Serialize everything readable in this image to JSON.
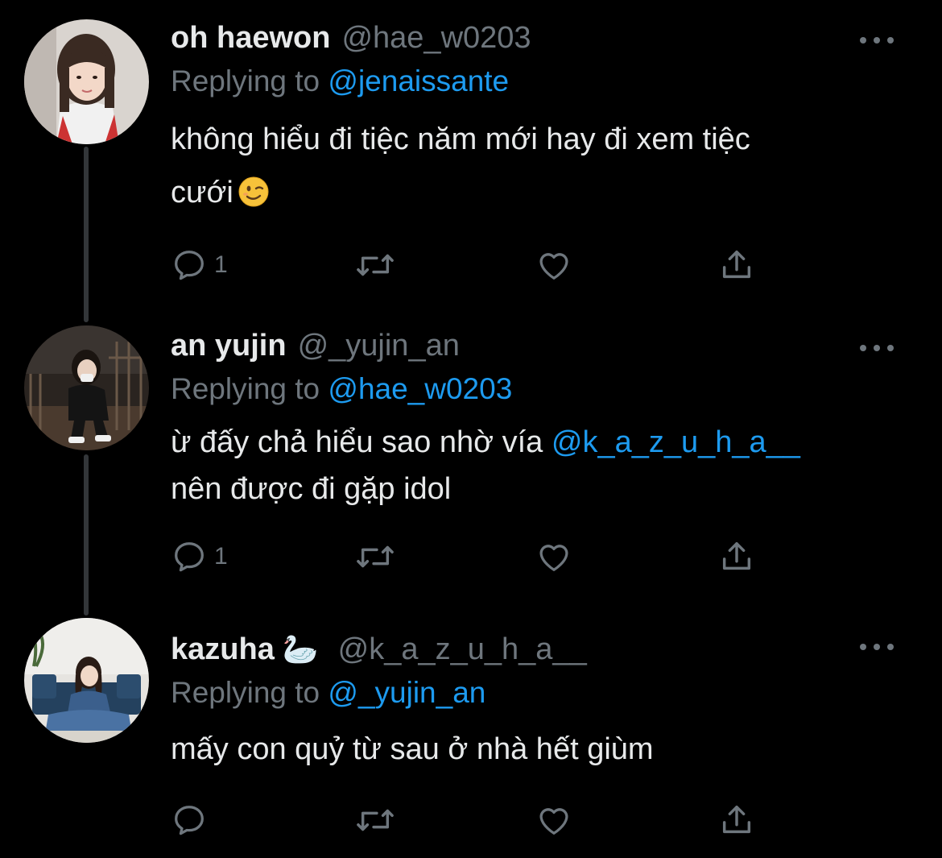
{
  "tweets": [
    {
      "display_name": "oh haewon",
      "handle": "@hae_w0203",
      "replying_label": "Replying to",
      "replying_to": "@jenaissante",
      "text_lines": [
        "không hiểu đi tiệc năm mới hay đi xem tiệc",
        "cưới"
      ],
      "inline_emoji": "winking-face",
      "reply_count": "1"
    },
    {
      "display_name": "an yujin",
      "handle": "@_yujin_an",
      "replying_label": "Replying to",
      "replying_to": "@hae_w0203",
      "text_line1": "ừ đấy chả hiểu sao nhờ vía",
      "text_mention": "@k_a_z_u_h_a__",
      "text_line2": "nên được đi gặp idol",
      "reply_count": "1"
    },
    {
      "display_name": "kazuha",
      "name_emoji": "🦢",
      "handle": "@k_a_z_u_h_a__",
      "replying_label": "Replying to",
      "replying_to": "@_yujin_an",
      "text_lines": [
        "mấy con quỷ từ sau ở nhà hết giùm"
      ],
      "reply_count": ""
    }
  ],
  "icons": [
    "reply-icon",
    "retweet-icon",
    "like-icon",
    "share-icon",
    "more-icon"
  ],
  "colors": {
    "background": "#000000",
    "text": "#e7e9ea",
    "secondary": "#6e767d",
    "accent": "#1d9bf0",
    "thread_line": "#333639"
  }
}
